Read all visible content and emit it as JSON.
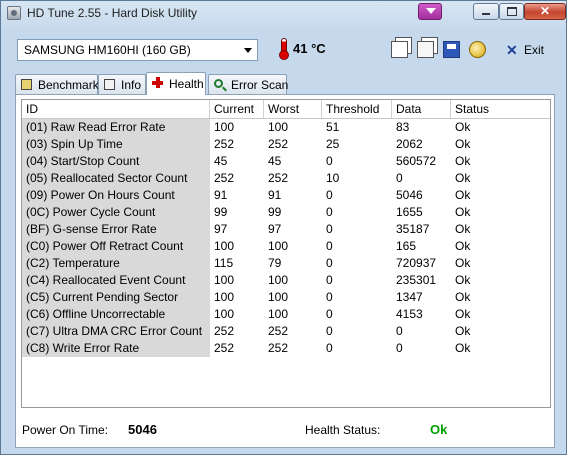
{
  "window": {
    "title": "HD Tune 2.55 - Hard Disk Utility",
    "close_glyph": "✕"
  },
  "toolbar": {
    "drive": "SAMSUNG HM160HI (160 GB)",
    "temperature": "41 °C",
    "exit_label": "Exit",
    "exit_glyph": "✕"
  },
  "tabs": [
    {
      "label": "Benchmark",
      "icon": "benchmark-icon"
    },
    {
      "label": "Info",
      "icon": "info-icon"
    },
    {
      "label": "Health",
      "icon": "health-cross-icon",
      "active": true
    },
    {
      "label": "Error Scan",
      "icon": "error-scan-icon"
    }
  ],
  "table": {
    "headers": [
      "ID",
      "Current",
      "Worst",
      "Threshold",
      "Data",
      "Status"
    ],
    "rows": [
      [
        "(01) Raw Read Error Rate",
        "100",
        "100",
        "51",
        "83",
        "Ok"
      ],
      [
        "(03) Spin Up Time",
        "252",
        "252",
        "25",
        "2062",
        "Ok"
      ],
      [
        "(04) Start/Stop Count",
        "45",
        "45",
        "0",
        "560572",
        "Ok"
      ],
      [
        "(05) Reallocated Sector Count",
        "252",
        "252",
        "10",
        "0",
        "Ok"
      ],
      [
        "(09) Power On Hours Count",
        "91",
        "91",
        "0",
        "5046",
        "Ok"
      ],
      [
        "(0C) Power Cycle Count",
        "99",
        "99",
        "0",
        "1655",
        "Ok"
      ],
      [
        "(BF) G-sense Error Rate",
        "97",
        "97",
        "0",
        "35187",
        "Ok"
      ],
      [
        "(C0) Power Off Retract Count",
        "100",
        "100",
        "0",
        "165",
        "Ok"
      ],
      [
        "(C2) Temperature",
        "115",
        "79",
        "0",
        "720937",
        "Ok"
      ],
      [
        "(C4) Reallocated Event Count",
        "100",
        "100",
        "0",
        "235301",
        "Ok"
      ],
      [
        "(C5) Current Pending Sector",
        "100",
        "100",
        "0",
        "1347",
        "Ok"
      ],
      [
        "(C6) Offline Uncorrectable",
        "100",
        "100",
        "0",
        "4153",
        "Ok"
      ],
      [
        "(C7) Ultra DMA CRC Error Count",
        "252",
        "252",
        "0",
        "0",
        "Ok"
      ],
      [
        "(C8) Write Error Rate",
        "252",
        "252",
        "0",
        "0",
        "Ok"
      ]
    ]
  },
  "footer": {
    "power_on_label": "Power On Time:",
    "power_on_value": "5046",
    "health_label": "Health Status:",
    "health_value": "Ok",
    "health_color": "#00a000"
  }
}
